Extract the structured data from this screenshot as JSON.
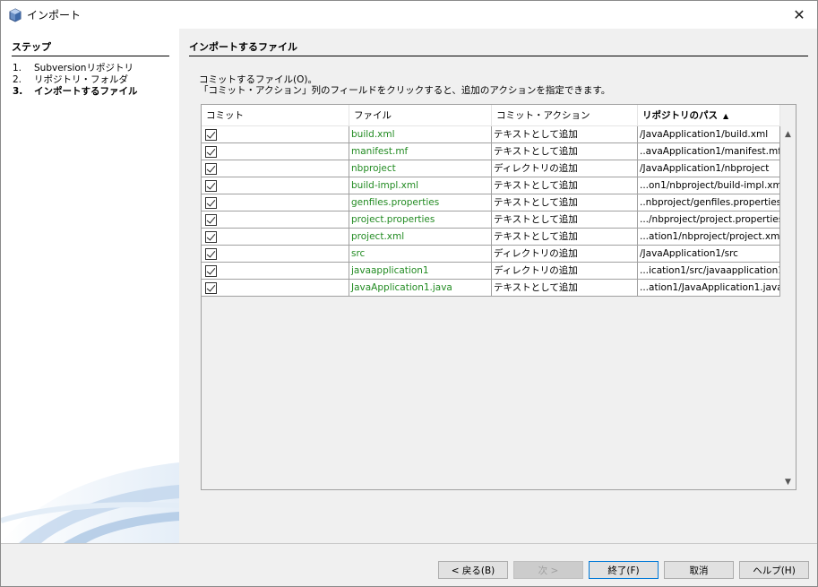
{
  "window": {
    "title": "インポート"
  },
  "steps": {
    "title": "ステップ",
    "items": [
      {
        "num": "1.",
        "label": "Subversionリポジトリ"
      },
      {
        "num": "2.",
        "label": "リポジトリ・フォルダ"
      },
      {
        "num": "3.",
        "label": "インポートするファイル"
      }
    ]
  },
  "main": {
    "title": "インポートするファイル",
    "desc1": "コミットするファイル(O)。",
    "desc2": "「コミット・アクション」列のフィールドをクリックすると、追加のアクションを指定できます。"
  },
  "table": {
    "headers": [
      "コミット",
      "ファイル",
      "コミット・アクション",
      "リポジトリのパス"
    ],
    "sort_indicator": "▲",
    "rows": [
      {
        "commit": true,
        "file": "build.xml",
        "action": "テキストとして追加",
        "path": "/JavaApplication1/build.xml"
      },
      {
        "commit": true,
        "file": "manifest.mf",
        "action": "テキストとして追加",
        "path": "..avaApplication1/manifest.mf"
      },
      {
        "commit": true,
        "file": "nbproject",
        "action": "ディレクトリの追加",
        "path": "/JavaApplication1/nbproject"
      },
      {
        "commit": true,
        "file": "build-impl.xml",
        "action": "テキストとして追加",
        "path": "...on1/nbproject/build-impl.xml"
      },
      {
        "commit": true,
        "file": "genfiles.properties",
        "action": "テキストとして追加",
        "path": "..nbproject/genfiles.properties"
      },
      {
        "commit": true,
        "file": "project.properties",
        "action": "テキストとして追加",
        "path": ".../nbproject/project.properties"
      },
      {
        "commit": true,
        "file": "project.xml",
        "action": "テキストとして追加",
        "path": "...ation1/nbproject/project.xml"
      },
      {
        "commit": true,
        "file": "src",
        "action": "ディレクトリの追加",
        "path": "/JavaApplication1/src"
      },
      {
        "commit": true,
        "file": "javaapplication1",
        "action": "ディレクトリの追加",
        "path": "...ication1/src/javaapplication1"
      },
      {
        "commit": true,
        "file": "JavaApplication1.java",
        "action": "テキストとして追加",
        "path": "...ation1/JavaApplication1.java"
      }
    ]
  },
  "buttons": {
    "back": "< 戻る(B)",
    "next": "次 >",
    "finish": "終了(F)",
    "cancel": "取消",
    "help": "ヘルプ(H)"
  },
  "colors": {
    "file_text": "#228b22",
    "default_button_border": "#0078d7"
  }
}
